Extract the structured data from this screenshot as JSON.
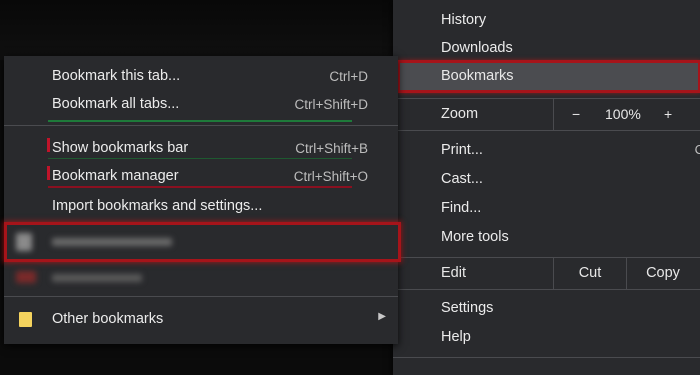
{
  "main_menu": {
    "history": "History",
    "downloads": "Downloads",
    "bookmarks": "Bookmarks",
    "zoom": {
      "label": "Zoom",
      "minus": "−",
      "value": "100%",
      "plus": "+"
    },
    "print": "Print...",
    "print_shortcut": "C",
    "cast": "Cast...",
    "find": "Find...",
    "more_tools": "More tools",
    "edit": {
      "label": "Edit",
      "cut": "Cut",
      "copy": "Copy"
    },
    "settings": "Settings",
    "help": "Help"
  },
  "bookmarks_menu": {
    "items": [
      {
        "label": "Bookmark this tab...",
        "shortcut": "Ctrl+D"
      },
      {
        "label": "Bookmark all tabs...",
        "shortcut": "Ctrl+Shift+D"
      },
      {
        "label": "Show bookmarks bar",
        "shortcut": "Ctrl+Shift+B"
      },
      {
        "label": "Bookmark manager",
        "shortcut": "Ctrl+Shift+O"
      },
      {
        "label": "Import bookmarks and settings...",
        "shortcut": ""
      }
    ],
    "other_bookmarks": "Other bookmarks"
  },
  "colors": {
    "menu_bg": "#292a2d",
    "highlight": "#4b4c50",
    "annotation_red": "#a6141a",
    "annotation_green": "#1e7a3a",
    "folder": "#f4d35e"
  }
}
